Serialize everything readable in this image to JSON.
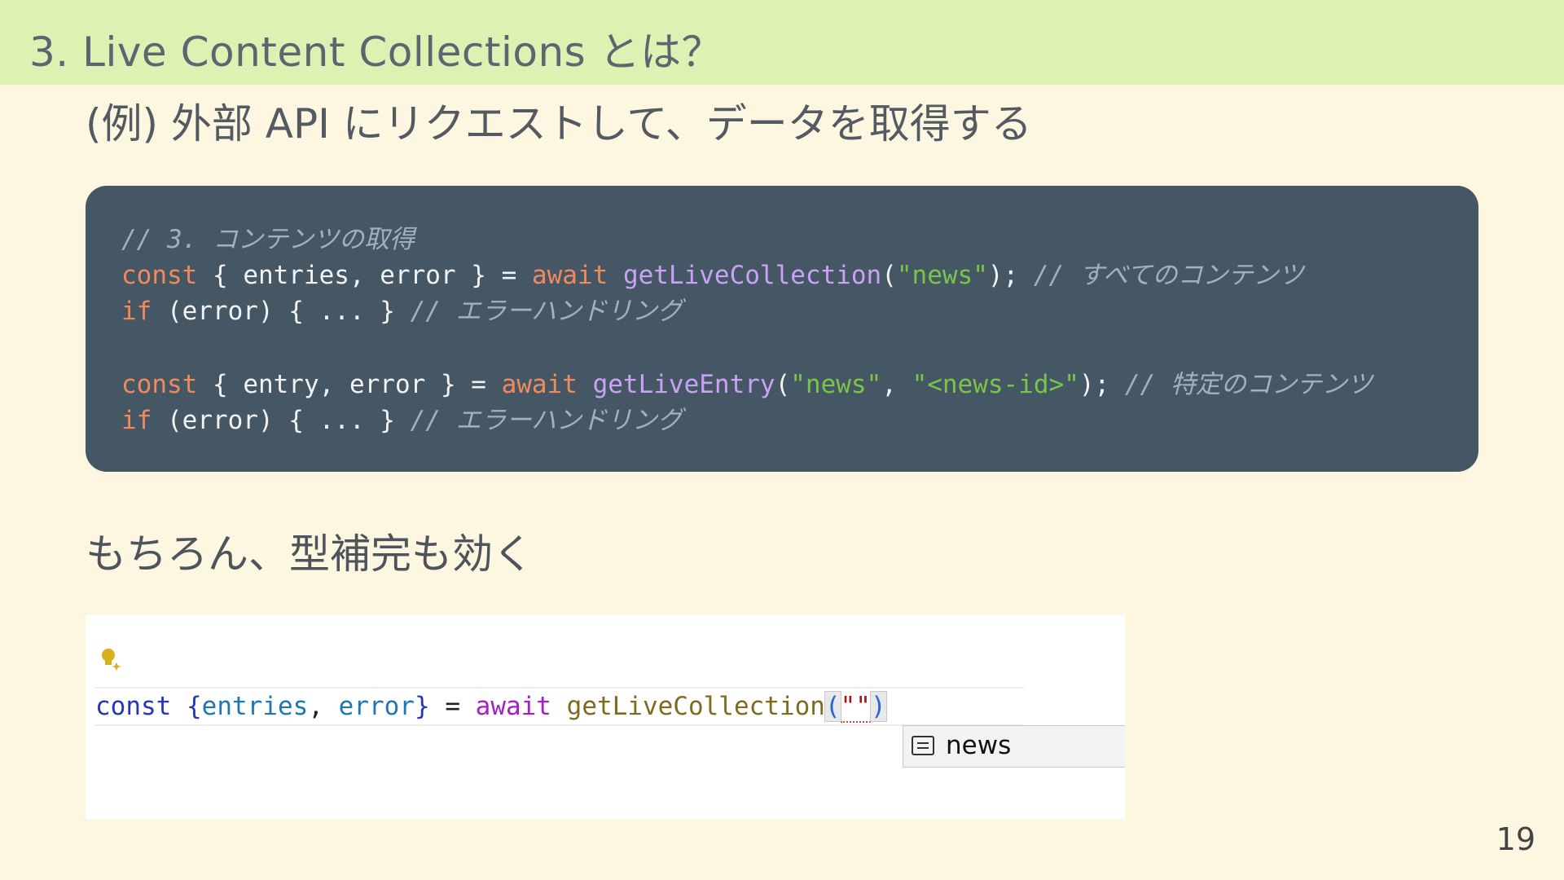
{
  "header": {
    "title": "3. Live Content Collections とは？"
  },
  "subtitle": "(例) 外部 API にリクエストして、データを取得する",
  "code": {
    "comment_1": "// 3. コンテンツの取得",
    "kw_const": "const",
    "kw_if": "if",
    "kw_await": "await",
    "line2_destructure": " { entries, error } = ",
    "fn_getLiveCollection": "getLiveCollection",
    "str_news": "\"news\"",
    "line2_end": ");",
    "comment_all": "// すべてのコンテンツ",
    "if_body": " (error) { ... } ",
    "comment_error": "// エラーハンドリング",
    "line5_destructure": " { entry, error } = ",
    "fn_getLiveEntry": "getLiveEntry",
    "comma": ", ",
    "str_news_id": "\"<news-id>\"",
    "comment_specific": "// 特定のコンテンツ"
  },
  "section2": {
    "heading": "もちろん、型補完も効く"
  },
  "editor": {
    "kw_const": "const",
    "destructure_open": "{",
    "var_entries": "entries",
    "comma": ", ",
    "var_error": "error",
    "destructure_close": "}",
    "equals": " = ",
    "kw_await": "await",
    "fn_name": "getLiveCollection",
    "paren_open": "(",
    "string_literal": "\"\"",
    "paren_close": ")",
    "suggestion_label": "news",
    "icons": {
      "lightbulb": "lightbulb-sparkle-icon",
      "suggestion": "text-value-icon"
    }
  },
  "page_number": "19"
}
